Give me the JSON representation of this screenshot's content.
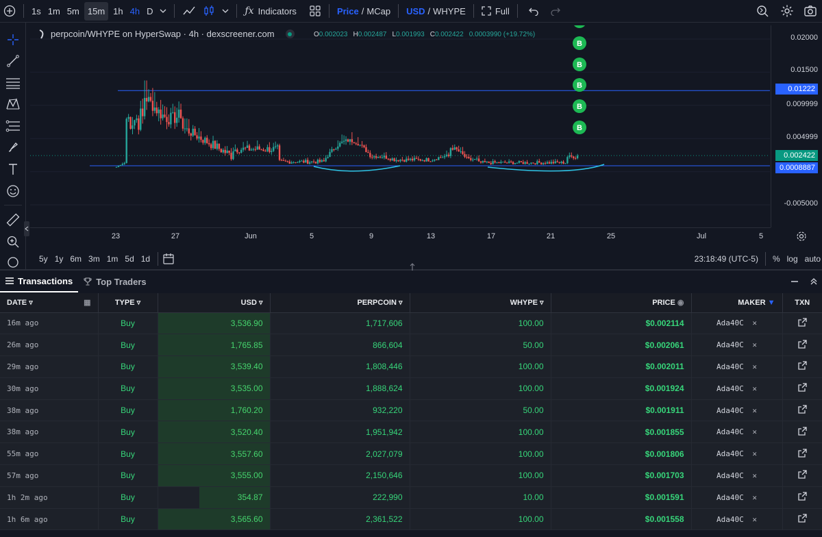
{
  "toolbar": {
    "intervals": [
      "1s",
      "1m",
      "5m",
      "15m",
      "1h",
      "4h",
      "D"
    ],
    "indicators_label": "Indicators",
    "price_label": "Price",
    "mcap_label": "MCap",
    "usd_label": "USD",
    "whype_label": "WHYPE",
    "full_label": "Full"
  },
  "chart": {
    "title": "perpcoin/WHYPE on HyperSwap · 4h · dexscreener.com",
    "ohlc": {
      "o": "0.002023",
      "h": "0.002487",
      "l": "0.001993",
      "c": "0.002422",
      "chg": "0.0003990 (+19.72%)"
    },
    "price_labels": [
      "0.02000",
      "0.01500",
      "0.009999",
      "0.004999",
      "-0.005000"
    ],
    "tag_top": "0.01222",
    "tag_last": "0.002422",
    "tag_bottom": "0.0008887",
    "time_labels": [
      "23",
      "27",
      "Jun",
      "5",
      "9",
      "13",
      "17",
      "21",
      "25",
      "Jul",
      "5"
    ],
    "buy_marker": "B",
    "colors": {
      "up": "#26a69a",
      "down": "#ef5350",
      "line": "#2962ff",
      "arc": "#2ec4e6",
      "marker": "#1db954"
    }
  },
  "rangebar": {
    "ranges": [
      "5y",
      "1y",
      "6m",
      "3m",
      "1m",
      "5d",
      "1d"
    ],
    "time": "23:18:49 (UTC-5)",
    "pct": "%",
    "log": "log",
    "auto": "auto"
  },
  "panel": {
    "tab_transactions": "Transactions",
    "tab_top_traders": "Top Traders"
  },
  "table": {
    "headers": {
      "date": "DATE",
      "type": "TYPE",
      "usd": "USD",
      "perpcoin": "PERPCOIN",
      "whype": "WHYPE",
      "price": "PRICE",
      "maker": "MAKER",
      "txn": "TXN"
    },
    "rows": [
      {
        "date": "16m ago",
        "type": "Buy",
        "usd": "3,536.90",
        "usd_frac": 1.0,
        "perpcoin": "1,717,606",
        "whype": "100.00",
        "price": "$0.002114",
        "maker": "Ada40C"
      },
      {
        "date": "26m ago",
        "type": "Buy",
        "usd": "1,765.85",
        "usd_frac": 1.0,
        "perpcoin": "866,604",
        "whype": "50.00",
        "price": "$0.002061",
        "maker": "Ada40C"
      },
      {
        "date": "29m ago",
        "type": "Buy",
        "usd": "3,539.40",
        "usd_frac": 1.0,
        "perpcoin": "1,808,446",
        "whype": "100.00",
        "price": "$0.002011",
        "maker": "Ada40C"
      },
      {
        "date": "30m ago",
        "type": "Buy",
        "usd": "3,535.00",
        "usd_frac": 1.0,
        "perpcoin": "1,888,624",
        "whype": "100.00",
        "price": "$0.001924",
        "maker": "Ada40C"
      },
      {
        "date": "38m ago",
        "type": "Buy",
        "usd": "1,760.20",
        "usd_frac": 1.0,
        "perpcoin": "932,220",
        "whype": "50.00",
        "price": "$0.001911",
        "maker": "Ada40C"
      },
      {
        "date": "38m ago",
        "type": "Buy",
        "usd": "3,520.40",
        "usd_frac": 1.0,
        "perpcoin": "1,951,942",
        "whype": "100.00",
        "price": "$0.001855",
        "maker": "Ada40C"
      },
      {
        "date": "55m ago",
        "type": "Buy",
        "usd": "3,557.60",
        "usd_frac": 1.0,
        "perpcoin": "2,027,079",
        "whype": "100.00",
        "price": "$0.001806",
        "maker": "Ada40C"
      },
      {
        "date": "57m ago",
        "type": "Buy",
        "usd": "3,555.00",
        "usd_frac": 1.0,
        "perpcoin": "2,150,646",
        "whype": "100.00",
        "price": "$0.001703",
        "maker": "Ada40C"
      },
      {
        "date": "1h 2m ago",
        "type": "Buy",
        "usd": "354.87",
        "usd_frac": 0.63,
        "perpcoin": "222,990",
        "whype": "10.00",
        "price": "$0.001591",
        "maker": "Ada40C"
      },
      {
        "date": "1h 6m ago",
        "type": "Buy",
        "usd": "3,565.60",
        "usd_frac": 1.0,
        "perpcoin": "2,361,522",
        "whype": "100.00",
        "price": "$0.001558",
        "maker": "Ada40C"
      }
    ]
  }
}
